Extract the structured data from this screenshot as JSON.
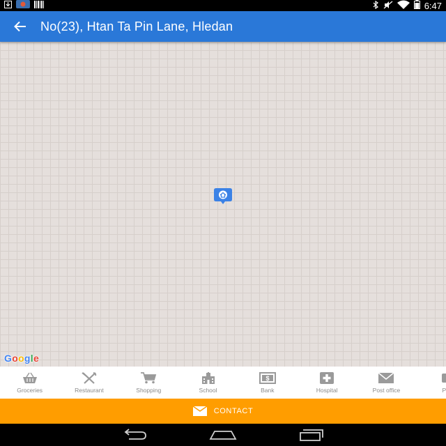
{
  "status_bar": {
    "time": "6:47",
    "icons": [
      "download-icon",
      "app-notification-icon",
      "barcode-icon",
      "bluetooth-icon",
      "mute-icon",
      "wifi-icon",
      "battery-icon"
    ]
  },
  "app_bar": {
    "title": "No(23), Htan Ta Pin Lane, Hledan",
    "back_icon": "arrow-back-icon",
    "color": "#2a78d8"
  },
  "map": {
    "attribution": "Google",
    "marker_icon": "home-marker-icon"
  },
  "categories": [
    {
      "label": "Groceries",
      "icon": "basket-icon"
    },
    {
      "label": "Restaurant",
      "icon": "cutlery-icon"
    },
    {
      "label": "Shopping",
      "icon": "cart-icon"
    },
    {
      "label": "School",
      "icon": "school-icon"
    },
    {
      "label": "Bank",
      "icon": "bank-icon"
    },
    {
      "label": "Hospital",
      "icon": "hospital-icon"
    },
    {
      "label": "Post office",
      "icon": "envelope-icon"
    },
    {
      "label": "Pa",
      "icon": "partial-icon"
    }
  ],
  "contact": {
    "label": "CONTACT",
    "icon": "mail-icon",
    "color": "#ff9d00"
  },
  "nav_bar": {
    "buttons": [
      "back-nav-icon",
      "home-nav-icon",
      "recents-nav-icon"
    ]
  }
}
